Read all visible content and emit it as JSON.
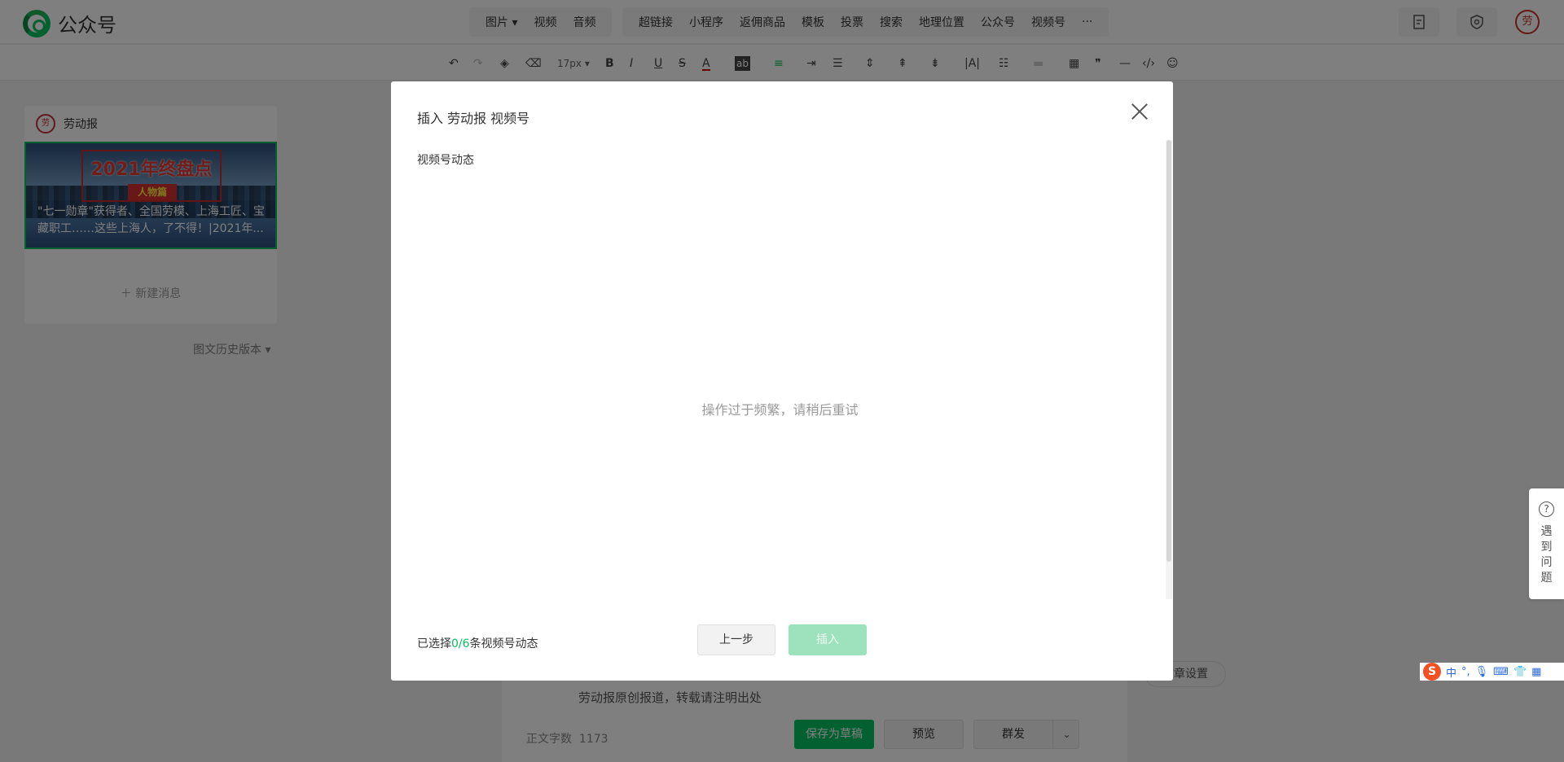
{
  "header": {
    "app_name": "公众号",
    "media_group": [
      "图片",
      "视频",
      "音频"
    ],
    "insert_group": [
      "超链接",
      "小程序",
      "返佣商品",
      "模板",
      "投票",
      "搜索",
      "地理位置",
      "公众号",
      "视频号",
      "···"
    ],
    "icons": [
      "document-icon",
      "shield-icon",
      "avatar"
    ],
    "avatar_text": "劳"
  },
  "toolbar": {
    "font_size": "17px",
    "bold": "B",
    "italic": "I",
    "underline": "U",
    "strike": "S",
    "font_color": "A",
    "bg_color": "ab"
  },
  "sidebar": {
    "account_name": "劳动报",
    "account_avatar": "劳",
    "cover_title": "2021年终盘点",
    "cover_subtitle": "人物篇",
    "cover_caption": "\"七一勋章\"获得者、全国劳模、上海工匠、宝藏职工……这些上海人，了不得！|2021年...",
    "new_message": "新建消息",
    "history": "图文历史版本"
  },
  "editor": {
    "origin_note": "劳动报原创报道，转载请注明出处",
    "word_count_label": "正文字数",
    "word_count": "1173",
    "save_draft": "保存为草稿",
    "preview": "预览",
    "publish": "群发",
    "article_settings": "文章设置"
  },
  "help": {
    "icon": "?",
    "label": "遇到问题"
  },
  "ime": {
    "logo": "S",
    "lang": "中"
  },
  "modal": {
    "title": "插入 劳动报 视频号",
    "section_label": "视频号动态",
    "empty_message": "操作过于频繁，请稍后重试",
    "selected_prefix": "已选择",
    "selected_count": "0/6",
    "selected_suffix": "条视频号动态",
    "prev_button": "上一步",
    "insert_button": "插入"
  }
}
